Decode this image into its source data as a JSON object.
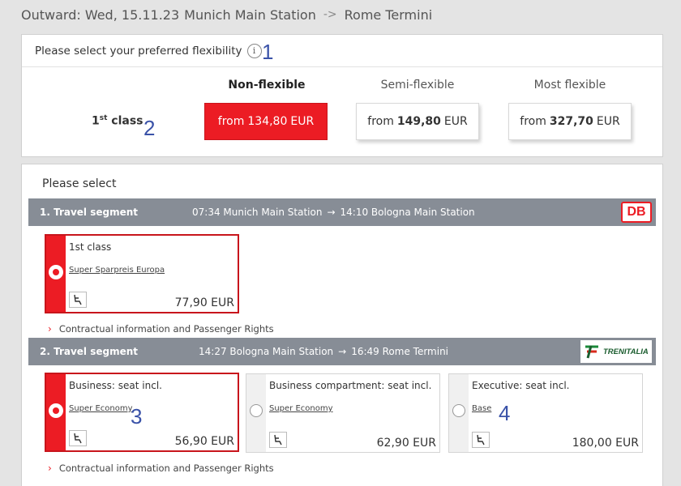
{
  "header": {
    "outward_label": "Outward: Wed, 15.11.23",
    "from": "Munich Main Station",
    "arrow": "->",
    "to": "Rome Termini"
  },
  "flexibility": {
    "prompt": "Please select your preferred flexibility",
    "info_icon": "i",
    "marker": "1",
    "class_label": "1",
    "class_sup": "st",
    "class_suffix": "class",
    "class_marker": "2",
    "options": [
      {
        "heading": "Non-flexible",
        "prefix": "from",
        "price": "134,80",
        "currency": "EUR",
        "selected": true
      },
      {
        "heading": "Semi-flexible",
        "prefix": "from",
        "price": "149,80",
        "currency": "EUR",
        "selected": false
      },
      {
        "heading": "Most flexible",
        "prefix": "from",
        "price": "327,70",
        "currency": "EUR",
        "selected": false
      }
    ]
  },
  "selection": {
    "title": "Please select",
    "segments": [
      {
        "title": "1. Travel segment",
        "dep": "07:34 Munich Main Station",
        "arrow": "→",
        "arr": "14:10 Bologna Main Station",
        "operator": "DB",
        "fares": [
          {
            "name": "1st class",
            "tariff": "Super Sparpreis Europa",
            "price": "77,90 EUR",
            "selected": true
          }
        ],
        "contract": "Contractual information and Passenger Rights"
      },
      {
        "title": "2. Travel segment",
        "dep": "14:27 Bologna Main Station",
        "arrow": "→",
        "arr": "16:49 Rome Termini",
        "operator": "TRENITALIA",
        "fares": [
          {
            "name": "Business: seat incl.",
            "tariff": "Super Economy",
            "price": "56,90 EUR",
            "selected": true,
            "marker": "3"
          },
          {
            "name": "Business compartment: seat incl.",
            "tariff": "Super Economy",
            "price": "62,90 EUR",
            "selected": false
          },
          {
            "name": "Executive: seat incl.",
            "tariff": "Base",
            "price": "180,00 EUR",
            "selected": false,
            "marker": "4"
          }
        ],
        "contract": "Contractual information and Passenger Rights"
      }
    ]
  },
  "colors": {
    "accent": "#ec1c24",
    "segment_bar": "#878d96",
    "marker": "#3a52a8"
  }
}
